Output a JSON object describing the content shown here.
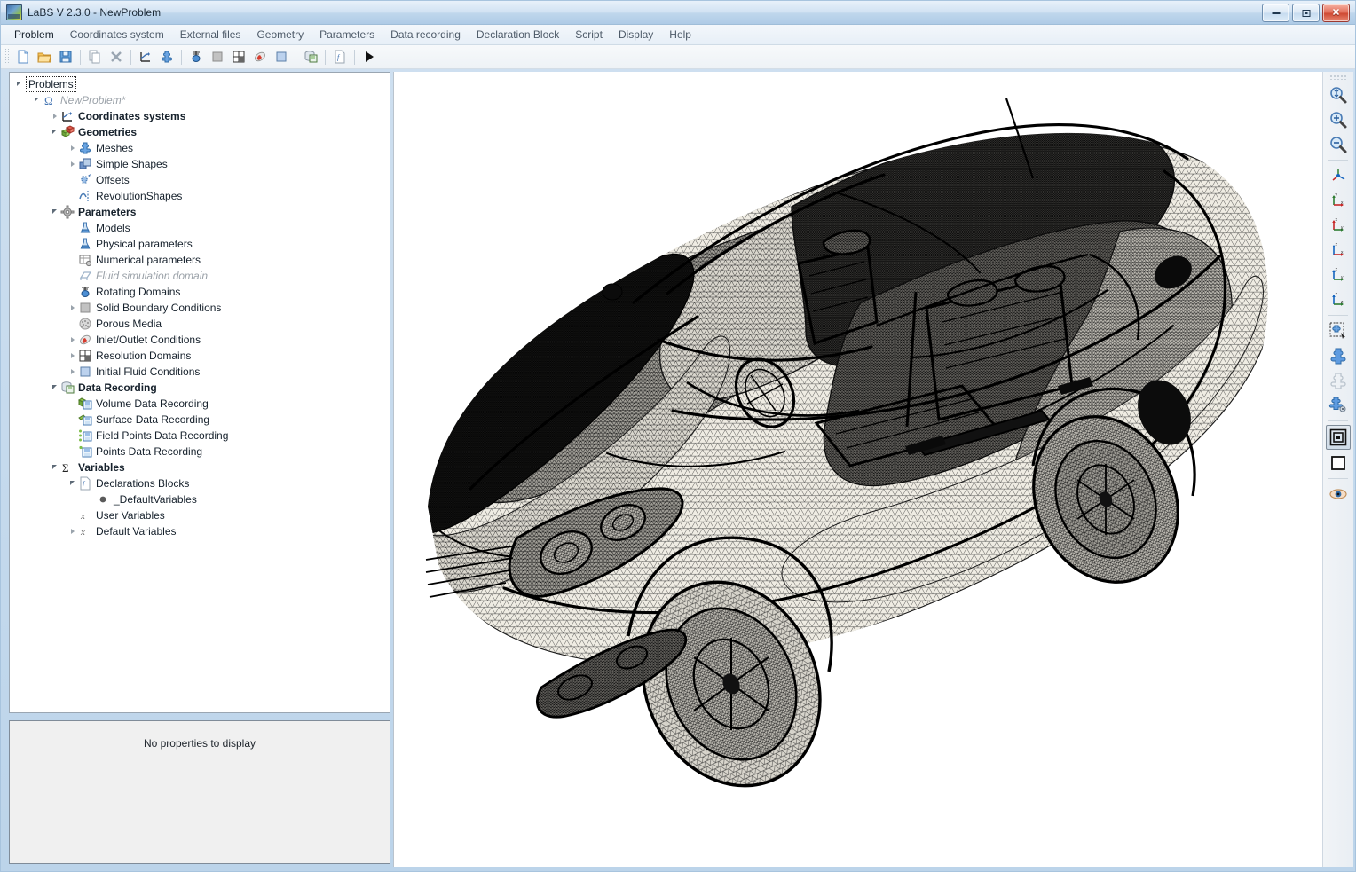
{
  "window": {
    "title": "LaBS V 2.3.0 - NewProblem",
    "app_icon": "labs-logo-icon",
    "buttons": {
      "minimize": "minimize",
      "maximize": "maximize",
      "close": "close"
    }
  },
  "menubar": {
    "items": [
      {
        "label": "Problem"
      },
      {
        "label": "Coordinates system"
      },
      {
        "label": "External files"
      },
      {
        "label": "Geometry"
      },
      {
        "label": "Parameters"
      },
      {
        "label": "Data recording"
      },
      {
        "label": "Declaration Block"
      },
      {
        "label": "Script"
      },
      {
        "label": "Display"
      },
      {
        "label": "Help"
      }
    ]
  },
  "toolbar": {
    "items": [
      {
        "name": "new-document-icon"
      },
      {
        "name": "open-folder-icon"
      },
      {
        "name": "save-disk-icon"
      },
      {
        "sep": true
      },
      {
        "name": "copy-icon"
      },
      {
        "name": "delete-x-icon"
      },
      {
        "sep": true
      },
      {
        "name": "coordinate-system-icon"
      },
      {
        "name": "mesh-puzzle-icon"
      },
      {
        "sep": true
      },
      {
        "name": "rotating-domain-icon"
      },
      {
        "name": "solid-boundary-icon"
      },
      {
        "name": "resolution-domain-icon"
      },
      {
        "name": "inlet-outlet-icon"
      },
      {
        "name": "initial-fluid-icon"
      },
      {
        "sep": true
      },
      {
        "name": "data-recording-icon"
      },
      {
        "sep": true
      },
      {
        "name": "declaration-block-icon"
      },
      {
        "sep": true
      },
      {
        "name": "run-play-icon"
      }
    ]
  },
  "tree": {
    "root_label": "Problems",
    "nodes": [
      {
        "depth": 0,
        "label": "Problems",
        "icon": "root-icon",
        "arrow": "open",
        "style": "plain",
        "focus": true
      },
      {
        "depth": 1,
        "label": "NewProblem*",
        "icon": "omega-icon",
        "arrow": "open",
        "style": "italic-grey"
      },
      {
        "depth": 2,
        "label": "Coordinates systems",
        "icon": "axes-icon",
        "arrow": "closed",
        "style": "bold"
      },
      {
        "depth": 2,
        "label": "Geometries",
        "icon": "geometries-cubes-icon",
        "arrow": "open",
        "style": "bold"
      },
      {
        "depth": 3,
        "label": "Meshes",
        "icon": "mesh-puzzle-icon",
        "arrow": "closed",
        "style": "plain"
      },
      {
        "depth": 3,
        "label": "Simple Shapes",
        "icon": "simple-shapes-icon",
        "arrow": "closed",
        "style": "plain"
      },
      {
        "depth": 3,
        "label": "Offsets",
        "icon": "offsets-icon",
        "arrow": "none",
        "style": "plain"
      },
      {
        "depth": 3,
        "label": "RevolutionShapes",
        "icon": "revolution-shapes-icon",
        "arrow": "none",
        "style": "plain"
      },
      {
        "depth": 2,
        "label": "Parameters",
        "icon": "gear-icon",
        "arrow": "open",
        "style": "bold"
      },
      {
        "depth": 3,
        "label": "Models",
        "icon": "flask-icon",
        "arrow": "none",
        "style": "plain"
      },
      {
        "depth": 3,
        "label": "Physical parameters",
        "icon": "flask-icon",
        "arrow": "none",
        "style": "plain"
      },
      {
        "depth": 3,
        "label": "Numerical parameters",
        "icon": "numerical-table-icon",
        "arrow": "none",
        "style": "plain"
      },
      {
        "depth": 3,
        "label": "Fluid simulation domain",
        "icon": "fluid-domain-icon",
        "arrow": "none",
        "style": "italic-grey"
      },
      {
        "depth": 3,
        "label": "Rotating Domains",
        "icon": "rotating-domain-icon",
        "arrow": "none",
        "style": "plain"
      },
      {
        "depth": 3,
        "label": "Solid Boundary Conditions",
        "icon": "solid-boundary-icon",
        "arrow": "closed",
        "style": "plain"
      },
      {
        "depth": 3,
        "label": "Porous Media",
        "icon": "porous-media-icon",
        "arrow": "none",
        "style": "plain"
      },
      {
        "depth": 3,
        "label": "Inlet/Outlet Conditions",
        "icon": "inlet-outlet-icon",
        "arrow": "closed",
        "style": "plain"
      },
      {
        "depth": 3,
        "label": "Resolution Domains",
        "icon": "resolution-domain-icon",
        "arrow": "closed",
        "style": "plain"
      },
      {
        "depth": 3,
        "label": "Initial Fluid Conditions",
        "icon": "initial-fluid-icon",
        "arrow": "closed",
        "style": "plain"
      },
      {
        "depth": 2,
        "label": "Data Recording",
        "icon": "data-recording-icon",
        "arrow": "open",
        "style": "bold"
      },
      {
        "depth": 3,
        "label": "Volume Data Recording",
        "icon": "volume-record-icon",
        "arrow": "none",
        "style": "plain"
      },
      {
        "depth": 3,
        "label": "Surface Data Recording",
        "icon": "surface-record-icon",
        "arrow": "none",
        "style": "plain"
      },
      {
        "depth": 3,
        "label": "Field Points Data Recording",
        "icon": "field-points-record-icon",
        "arrow": "none",
        "style": "plain"
      },
      {
        "depth": 3,
        "label": "Points Data Recording",
        "icon": "points-record-icon",
        "arrow": "none",
        "style": "plain"
      },
      {
        "depth": 2,
        "label": "Variables",
        "icon": "sigma-icon",
        "arrow": "open",
        "style": "bold"
      },
      {
        "depth": 3,
        "label": "Declarations Blocks",
        "icon": "declaration-block-icon",
        "arrow": "open",
        "style": "plain"
      },
      {
        "depth": 4,
        "label": "_DefaultVariables",
        "icon": "bullet-dot-icon",
        "arrow": "none",
        "style": "plain"
      },
      {
        "depth": 3,
        "label": "User Variables",
        "icon": "x-variable-icon",
        "arrow": "none",
        "style": "plain"
      },
      {
        "depth": 3,
        "label": "Default Variables",
        "icon": "x-variable-icon",
        "arrow": "closed",
        "style": "plain"
      }
    ]
  },
  "properties": {
    "empty_message": "No properties to display"
  },
  "right_toolbar": {
    "items": [
      {
        "name": "zoom-fit-icon",
        "selected": false
      },
      {
        "name": "zoom-in-icon",
        "selected": false
      },
      {
        "name": "zoom-out-icon",
        "selected": false
      },
      {
        "sep": true
      },
      {
        "name": "view-isometric-icon",
        "selected": false
      },
      {
        "name": "view-xy-icon",
        "selected": false
      },
      {
        "name": "view-yx-icon",
        "selected": false
      },
      {
        "name": "view-zx-icon",
        "selected": false
      },
      {
        "name": "view-zy-icon",
        "selected": false
      },
      {
        "name": "view-zz-icon",
        "selected": false
      },
      {
        "sep": true
      },
      {
        "name": "select-mesh-icon",
        "selected": false
      },
      {
        "name": "show-mesh-icon",
        "selected": false
      },
      {
        "name": "hide-mesh-icon",
        "selected": false
      },
      {
        "name": "mesh-properties-icon",
        "selected": false
      },
      {
        "sep": true
      },
      {
        "name": "bounding-box-icon",
        "selected": true
      },
      {
        "name": "outline-box-icon",
        "selected": false
      },
      {
        "sep": true
      },
      {
        "name": "visibility-eye-icon",
        "selected": false
      }
    ]
  },
  "viewport": {
    "model_name": "car-wireframe-mesh",
    "background": "#ffffff"
  },
  "colors": {
    "accent": "#3a6ea5",
    "titlebar_start": "#e8f1fa",
    "titlebar_end": "#aecbe6",
    "panel_bg": "#f0f0f0",
    "frame": "#bcd4ea",
    "close_button": "#cf4a33"
  }
}
